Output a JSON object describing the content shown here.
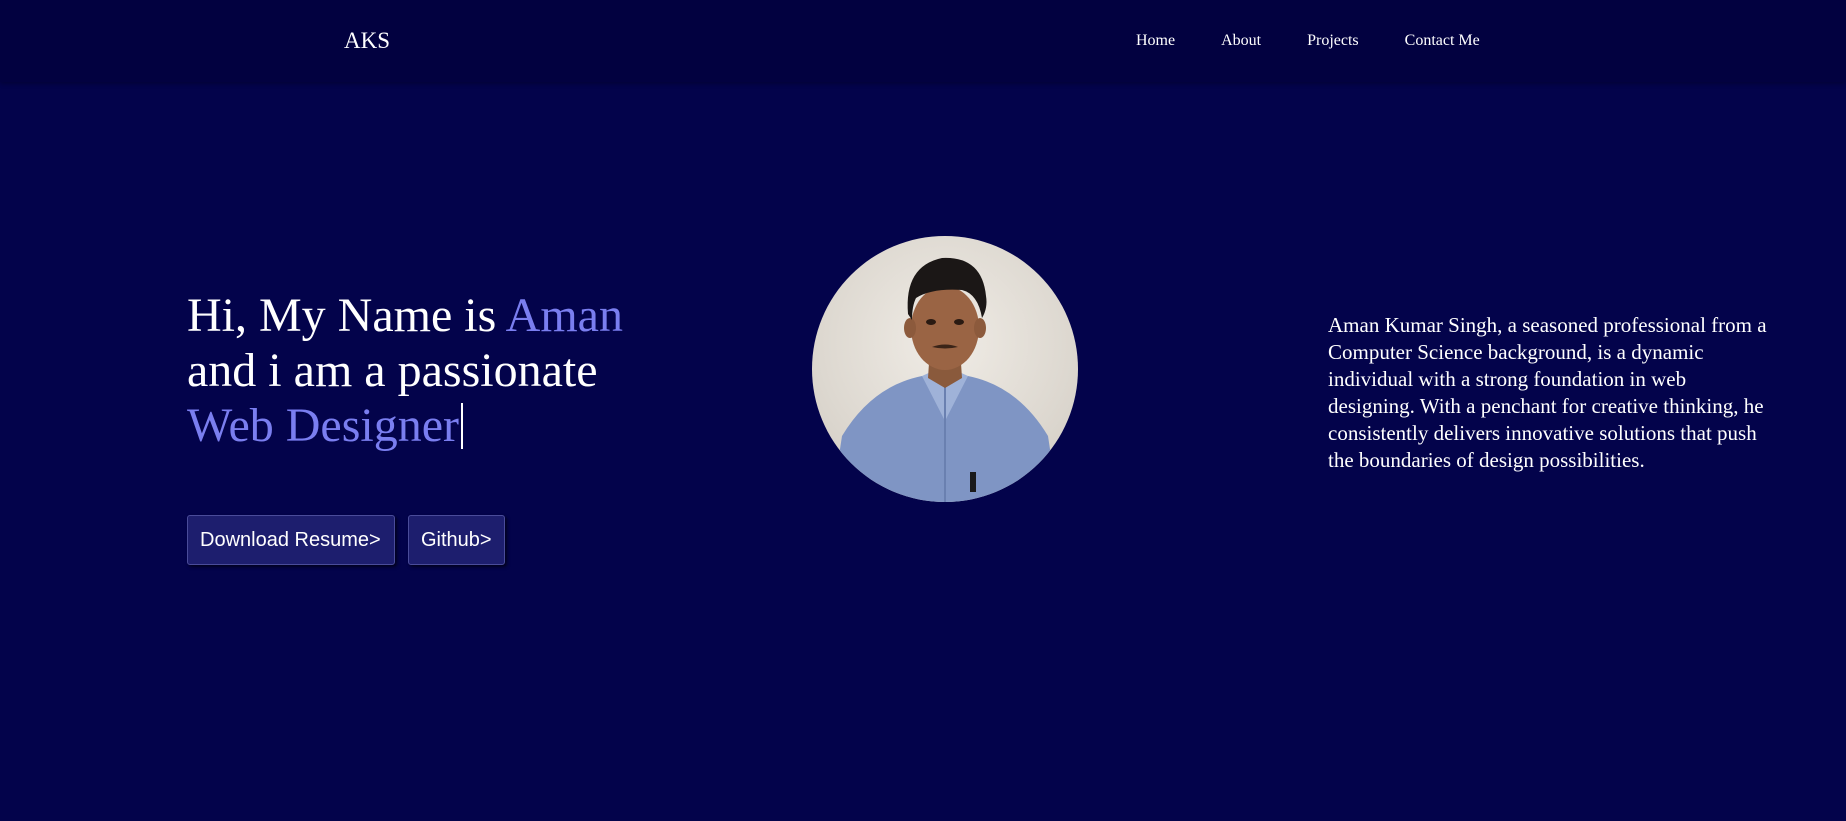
{
  "nav": {
    "logo": "AKS",
    "links": [
      "Home",
      "About",
      "Projects",
      "Contact Me"
    ]
  },
  "hero": {
    "line1_prefix": "Hi, My Name is ",
    "name": "Aman",
    "line2": "and i am a passionate",
    "role": "Web Designer",
    "buttons": {
      "resume": "Download Resume>",
      "github": "Github>"
    }
  },
  "profile_photo": {
    "description_icon": "profile-photo"
  },
  "bio": "Aman Kumar Singh, a seasoned professional from a Computer Science background, is a dynamic individual with a strong foundation in web designing. With a penchant for creative thinking, he consistently delivers innovative solutions that push the boundaries of design possibilities.",
  "colors": {
    "background": "#03034b",
    "navbar": "#020140",
    "accent": "#7a7ef0",
    "button": "#1d1e6e"
  }
}
